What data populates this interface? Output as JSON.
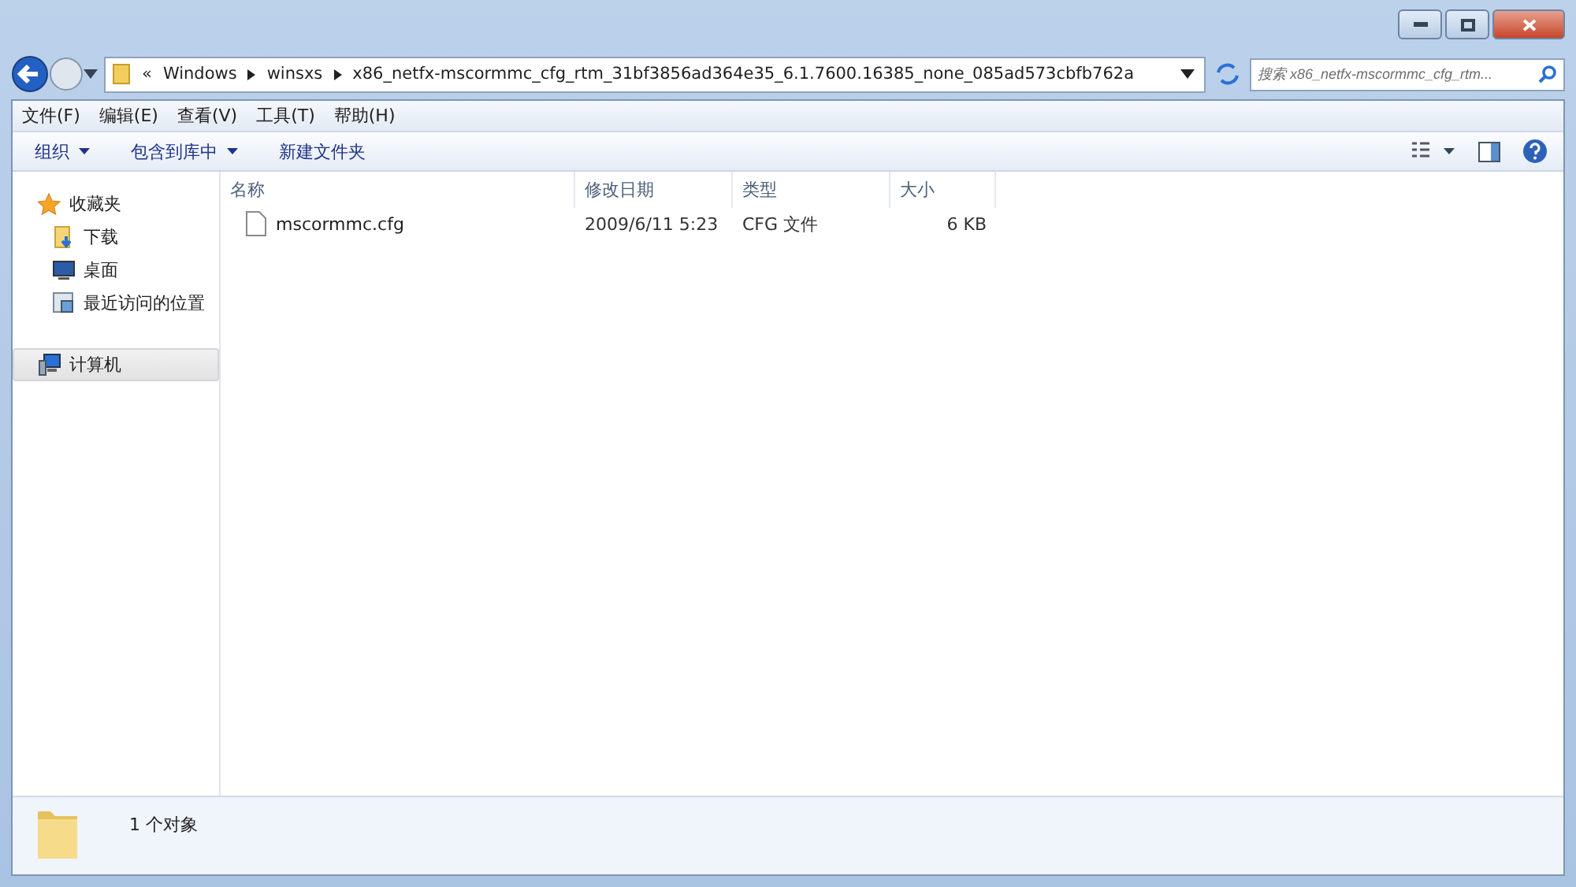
{
  "address_bar": {
    "segments": [
      "«",
      "Windows",
      "winsxs",
      "x86_netfx-mscormmc_cfg_rtm_31bf3856ad364e35_6.1.7600.16385_none_085ad573cbfb762a"
    ]
  },
  "search": {
    "placeholder": "搜索 x86_netfx-mscormmc_cfg_rtm..."
  },
  "menu": [
    "文件(F)",
    "编辑(E)",
    "查看(V)",
    "工具(T)",
    "帮助(H)"
  ],
  "toolbar": [
    {
      "label": "组织",
      "dropdown": true
    },
    {
      "label": "包含到库中",
      "dropdown": true
    },
    {
      "label": "新建文件夹",
      "dropdown": false
    }
  ],
  "sidebar": {
    "items": [
      {
        "label": "收藏夹",
        "selected": false,
        "children": [
          {
            "label": "下载",
            "selected": false
          },
          {
            "label": "桌面",
            "selected": false
          },
          {
            "label": "最近访问的位置",
            "selected": false
          }
        ]
      },
      {
        "label": "计算机",
        "selected": true
      }
    ]
  },
  "table": {
    "columns": [
      "名称",
      "修改日期",
      "类型",
      "大小"
    ],
    "rows": [
      {
        "name": "mscormmc.cfg",
        "modified": "2009/6/11 5:23",
        "type": "CFG 文件",
        "size": "6 KB"
      }
    ]
  },
  "status_bar": {
    "text": "1 个对象"
  }
}
